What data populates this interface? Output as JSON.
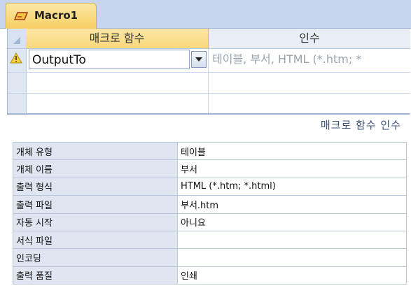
{
  "tab": {
    "title": "Macro1"
  },
  "grid": {
    "headers": {
      "action": "매크로 함수",
      "arguments": "인수"
    },
    "row1": {
      "action": "OutputTo",
      "arguments": "테이블, 부서, HTML (*.htm; *"
    }
  },
  "section": {
    "title": "매크로 함수 인수"
  },
  "arguments": [
    {
      "label": "개체 유형",
      "value": "테이블"
    },
    {
      "label": "개체 이름",
      "value": "부서"
    },
    {
      "label": "출력 형식",
      "value": "HTML (*.htm; *.html)"
    },
    {
      "label": "출력 파일",
      "value": "부서.htm"
    },
    {
      "label": "자동 시작",
      "value": "아니요"
    },
    {
      "label": "서식 파일",
      "value": ""
    },
    {
      "label": "인코딩",
      "value": ""
    },
    {
      "label": "출력 품질",
      "value": "인쇄"
    }
  ],
  "colors": {
    "tab_gold": "#f6cf61",
    "header_blue": "#c7d6ec",
    "grid_line": "#b9c6da"
  }
}
